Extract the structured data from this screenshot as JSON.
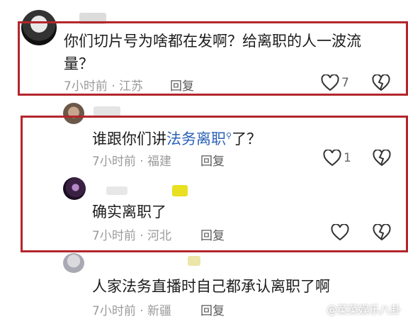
{
  "comments": [
    {
      "text": "你们切片号为啥都在发啊？给离职的人一波流量？",
      "time": "7小时前",
      "sep": "·",
      "location": "江苏",
      "reply_label": "回复",
      "likes": "7"
    },
    {
      "text_prefix": "谁跟你们讲",
      "text_link": "法务离职",
      "text_suffix": "了？",
      "time": "7小时前",
      "sep": "·",
      "location": "福建",
      "reply_label": "回复",
      "likes": "1"
    },
    {
      "text": "确实离职了",
      "time": "7小时前",
      "sep": "·",
      "location": "河北",
      "reply_label": "回复"
    },
    {
      "text": "人家法务直播时自己都承认离职了啊",
      "time": "7小时前",
      "sep": "·",
      "location": "新疆",
      "reply_label": "回复"
    }
  ],
  "watermark": "@菜菜娱乐八卦",
  "colors": {
    "highlight_box": "#b3262c",
    "link": "#2c62b6"
  }
}
